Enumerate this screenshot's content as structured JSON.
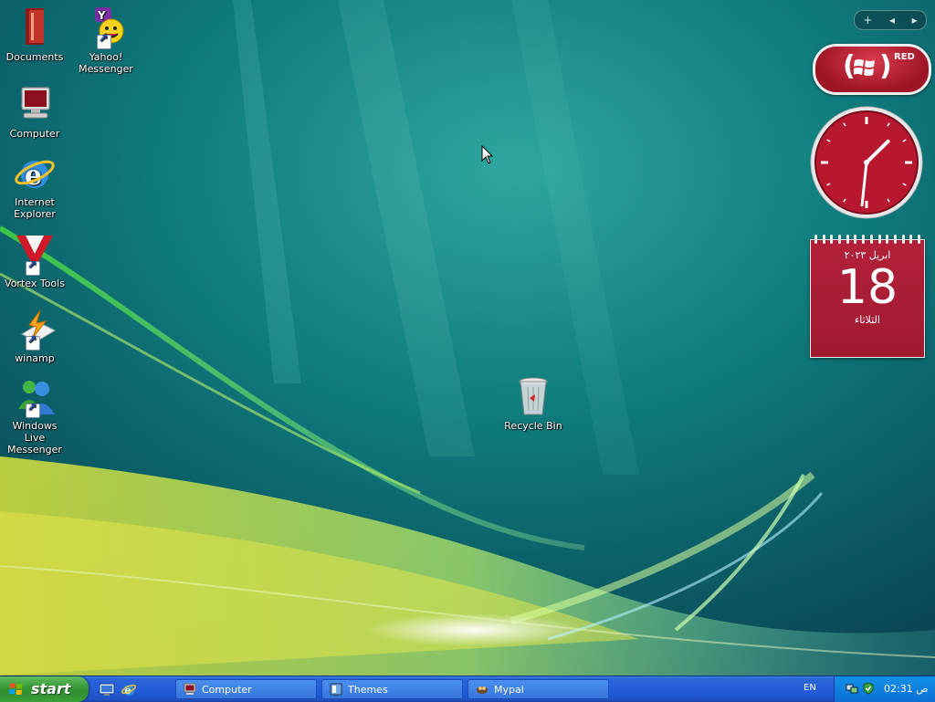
{
  "desktop": {
    "icons": [
      {
        "label": "Documents",
        "icon": "folder-icon"
      },
      {
        "label": "Yahoo! Messenger",
        "icon": "yahoo-messenger-icon"
      },
      {
        "label": "Computer",
        "icon": "computer-icon"
      },
      {
        "label": "Internet Explorer",
        "icon": "internet-explorer-icon"
      },
      {
        "label": "Vortex Tools",
        "icon": "vortex-tools-icon"
      },
      {
        "label": "winamp",
        "icon": "winamp-icon"
      },
      {
        "label": "Windows Live Messenger",
        "icon": "windows-live-messenger-icon"
      },
      {
        "label": "Recycle Bin",
        "icon": "recycle-bin-icon"
      }
    ]
  },
  "gadgets": {
    "toolbar": {
      "add": "+",
      "prev": "◂",
      "next": "▸"
    },
    "red_logo": {
      "open": "(",
      "close": ")",
      "text": "RED"
    },
    "clock": {
      "hour": 1,
      "minute": 31,
      "face_color": "#b8182f"
    },
    "calendar": {
      "month_year": "ابريل ٢٠٢٣",
      "day": "18",
      "weekday": "الثلاثاء",
      "color": "#a51c33"
    }
  },
  "taskbar": {
    "start_label": "start",
    "quick_launch": [
      "show-desktop-icon",
      "internet-explorer-icon"
    ],
    "tasks": [
      {
        "label": "Computer",
        "icon": "computer-icon"
      },
      {
        "label": "Themes",
        "icon": "themes-icon"
      },
      {
        "label": "Mypal",
        "icon": "mypal-icon"
      }
    ],
    "language": "EN",
    "clock": "02:31 ص"
  },
  "colors": {
    "taskbar": "#245edb",
    "start": "#3a9b3a",
    "tray": "#0c6fd6",
    "gadget_red": "#b3203a"
  }
}
